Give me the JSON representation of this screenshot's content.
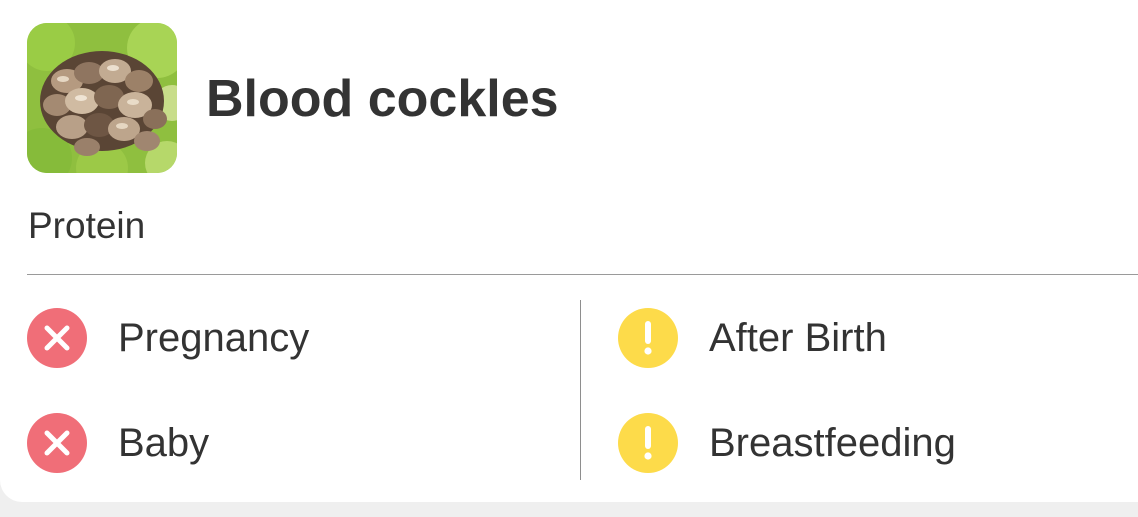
{
  "food": {
    "name": "Blood cockles",
    "category": "Protein",
    "image_icon": "blood-cockles-photo"
  },
  "colors": {
    "not_safe": "#f06e78",
    "caution": "#fddb4a",
    "text": "#333333"
  },
  "statuses": {
    "pregnancy": {
      "label": "Pregnancy",
      "level": "not-safe",
      "icon": "x-circle-icon"
    },
    "baby": {
      "label": "Baby",
      "level": "not-safe",
      "icon": "x-circle-icon"
    },
    "after_birth": {
      "label": "After Birth",
      "level": "caution",
      "icon": "exclamation-circle-icon"
    },
    "breastfeeding": {
      "label": "Breastfeeding",
      "level": "caution",
      "icon": "exclamation-circle-icon"
    }
  }
}
